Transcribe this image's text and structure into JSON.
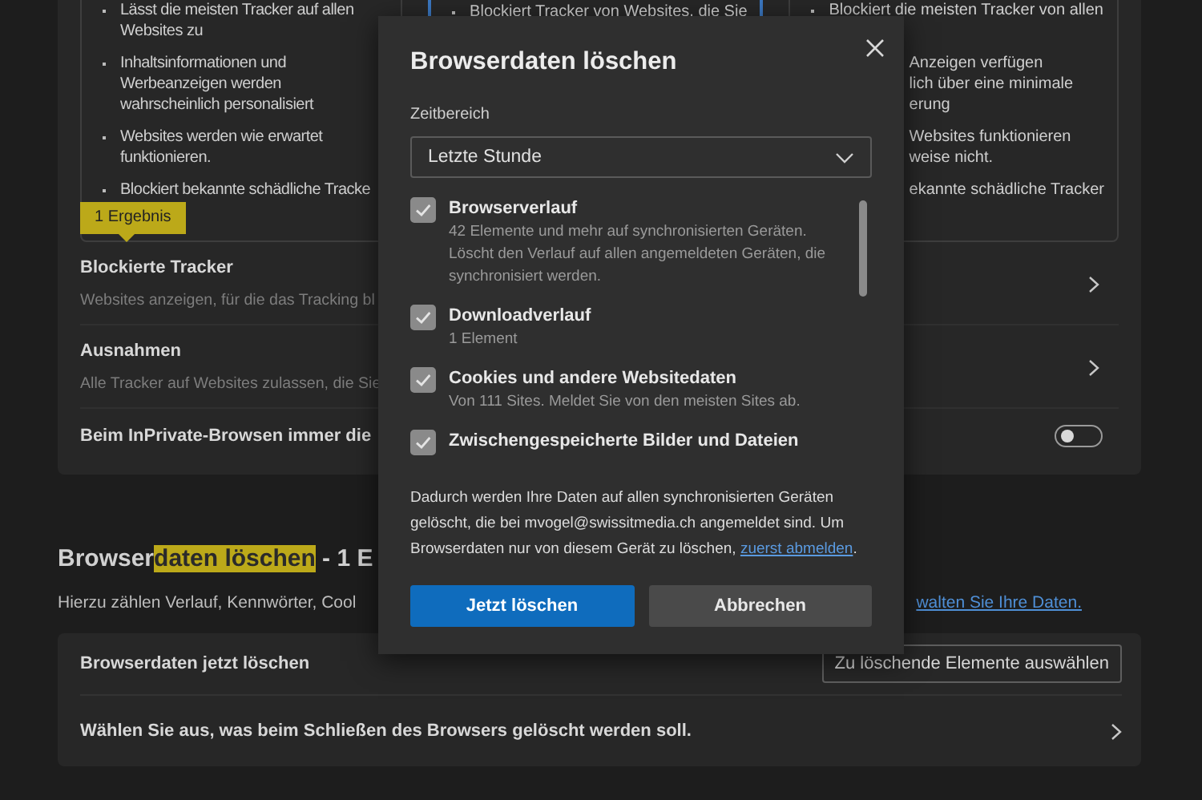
{
  "protection_levels": [
    {
      "selected": false,
      "items": [
        {
          "text": "Lässt die meisten Tracker auf allen Websites zu"
        },
        {
          "text": "Inhaltsinformationen und Werbeanzeigen werden wahrscheinlich personalisiert"
        },
        {
          "text": "Websites werden wie erwartet funktionieren."
        },
        {
          "text": "Blockiert bekannte schädliche Tracke"
        }
      ]
    },
    {
      "selected": true,
      "items": [
        {
          "text": "Blockiert Tracker von Websites, die Sie"
        }
      ]
    },
    {
      "selected": false,
      "items": [
        {
          "text": "Blockiert die meisten Tracker von allen"
        },
        {
          "fragments": [
            "Anzeigen verfügen",
            "lich über eine minimale",
            "erung"
          ]
        },
        {
          "fragments": [
            "Websites funktionieren",
            "weise nicht."
          ]
        },
        {
          "fragments": [
            "ekannte schädliche Tracker"
          ]
        }
      ]
    }
  ],
  "search_tooltip": "1 Ergebnis",
  "tracking_rows": [
    {
      "kind": "chevron",
      "title": "Blockierte Tracker",
      "description": "Websites anzeigen, für die das Tracking bl"
    },
    {
      "kind": "chevron",
      "title": "Ausnahmen",
      "description": "Alle Tracker auf Websites zulassen, die Sie"
    },
    {
      "kind": "toggle",
      "title": "Beim InPrivate-Browsen immer die",
      "on": false
    }
  ],
  "clear_section": {
    "heading_parts": [
      {
        "text": "Browser",
        "highlight": false
      },
      {
        "text": "daten löschen",
        "highlight": true
      },
      {
        "text": " - 1 E",
        "highlight": false
      }
    ],
    "description": "Hierzu zählen Verlauf, Kennwörter, Cool",
    "link": "walten Sie Ihre Daten.",
    "rows": [
      {
        "kind": "button",
        "title": "Browserdaten jetzt löschen",
        "button": "Zu löschende Elemente auswählen"
      },
      {
        "kind": "chevron",
        "title": "Wählen Sie aus, was beim Schließen des Browsers gelöscht werden soll."
      }
    ]
  },
  "dialog": {
    "title": "Browserdaten löschen",
    "time_range_label": "Zeitbereich",
    "time_range": "Letzte Stunde",
    "options": [
      {
        "title": "Browserverlauf",
        "description": "42 Elemente und mehr auf synchronisierten Geräten. Löscht den Verlauf auf allen angemeldeten Geräten, die synchronisiert werden.",
        "checked": true
      },
      {
        "title": "Downloadverlauf",
        "description": "1 Element",
        "checked": true
      },
      {
        "title": "Cookies und andere Websitedaten",
        "description": "Von 111 Sites. Meldet Sie von den meisten Sites ab.",
        "checked": true
      },
      {
        "title": "Zwischengespeicherte Bilder und Dateien",
        "checked": true
      }
    ],
    "info": "Dadurch werden Ihre Daten auf allen synchronisierten Geräten gelöscht, die bei mvogel@swissitmedia.ch angemeldet sind. Um Browserdaten nur von diesem Gerät zu löschen, ",
    "info_link": "zuerst abmelden",
    "info_end": ".",
    "buttons": [
      {
        "kind": "primary",
        "label": "Jetzt löschen"
      },
      {
        "kind": "secondary",
        "label": "Abbrechen"
      }
    ]
  }
}
